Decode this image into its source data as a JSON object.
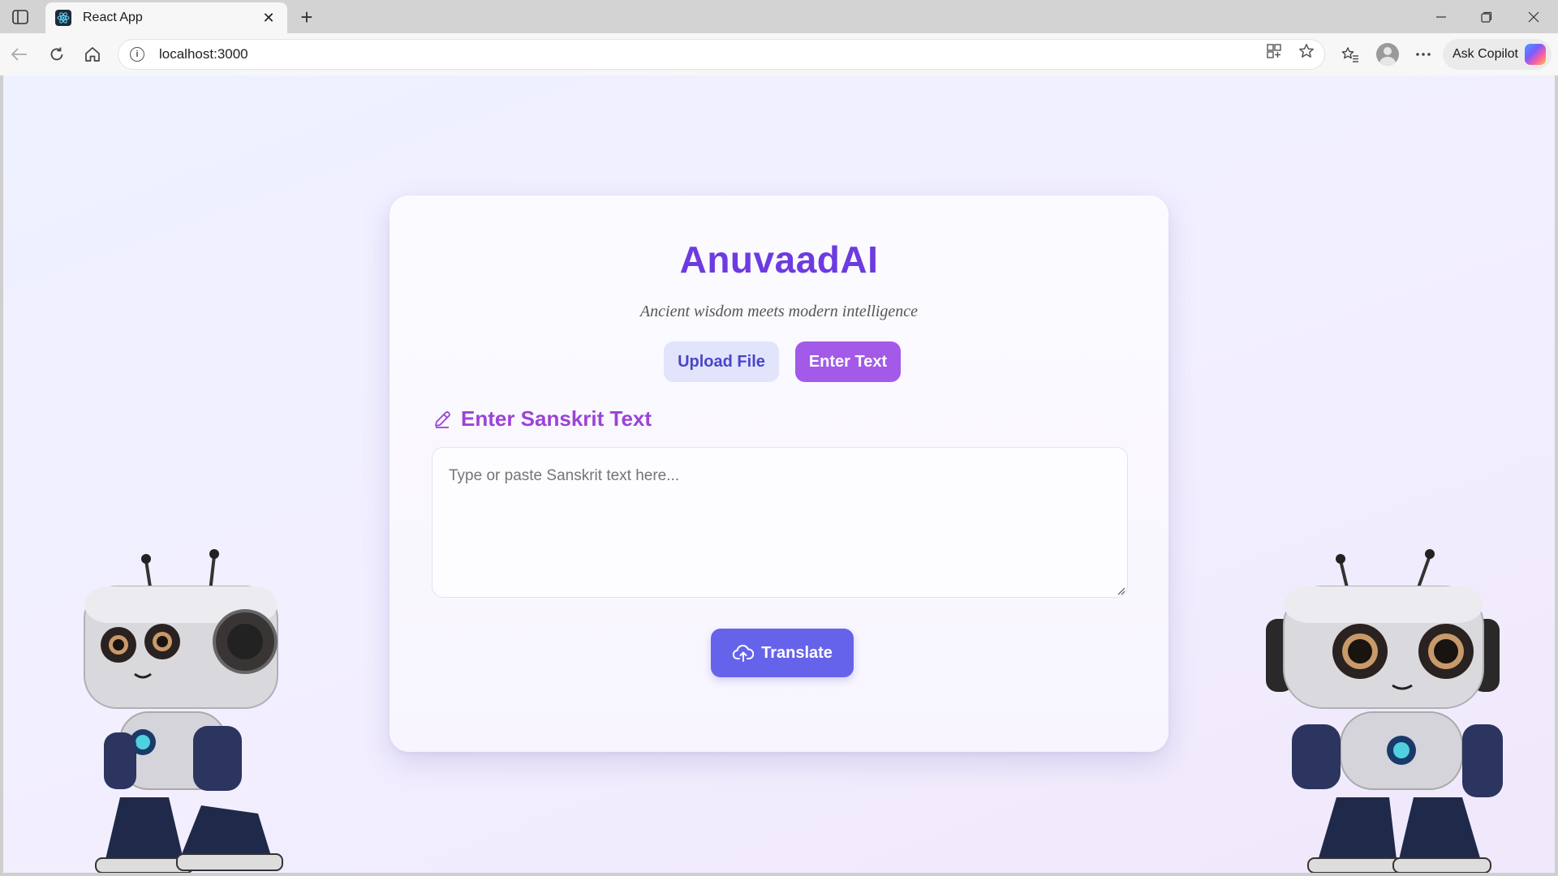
{
  "browser": {
    "tab_title": "React App",
    "url": "localhost:3000",
    "copilot_label": "Ask Copilot"
  },
  "app": {
    "title": "AnuvaadAI",
    "tagline": "Ancient wisdom meets modern intelligence",
    "mode_buttons": {
      "upload": "Upload File",
      "enter": "Enter Text",
      "selected": "Enter Text"
    },
    "section_label": "Enter Sanskrit Text",
    "textarea": {
      "value": "",
      "placeholder": "Type or paste Sanskrit text here..."
    },
    "translate_label": "Translate"
  },
  "icons": {
    "sidebar_toggle": "sidebar-toggle-icon",
    "favicon": "react-icon",
    "section": "pencil-icon",
    "translate": "cloud-upload-icon"
  },
  "colors": {
    "accent_title": "#6d3be0",
    "enter_button": "#a35ae8",
    "upload_button_bg": "#e1e4fb",
    "translate_button": "#6563ea",
    "section_label": "#9b43d6"
  }
}
